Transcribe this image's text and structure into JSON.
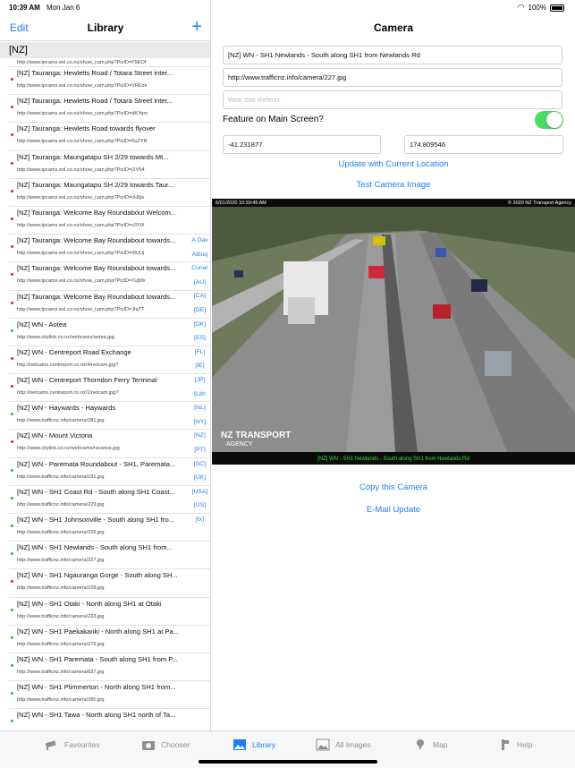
{
  "status": {
    "time": "10:39 AM",
    "date": "Mon Jan 6",
    "battery": "100%"
  },
  "left": {
    "edit_label": "Edit",
    "title": "Library",
    "add_label": "+",
    "section": "[NZ]",
    "items": [
      {
        "title": "",
        "url": "http://www.tpcams.eol.co.nz/show_cam.php?PicID=F5EOf",
        "dot": ""
      },
      {
        "title": "[NZ] Tauranga: Hewletts Road / Totara Street inter...",
        "url": "http://www.tpcams.eol.co.nz/show_cam.php?PicID=VREzk",
        "dot": "#e02020"
      },
      {
        "title": "[NZ] Tauranga: Hewletts Road / Totara Street inter...",
        "url": "http://www.tpcams.eol.co.nz/show_cam.php?PicID=dKYqm",
        "dot": "#e02020"
      },
      {
        "title": "[NZ] Tauranga: Hewletts Road towards flyover",
        "url": "http://www.tpcams.eol.co.nz/show_cam.php?PicID=0uZYR",
        "dot": "#e02020"
      },
      {
        "title": "[NZ] Tauranga: Maungatapu SH 2/29 towards Mt...",
        "url": "http://www.tpcams.eol.co.nz/show_cam.php?PicID=j1V54",
        "dot": "#e02020"
      },
      {
        "title": "[NZ] Tauranga: Maungatapu SH 2/29 towards Taur...",
        "url": "http://www.tpcams.eol.co.nz/show_cam.php?PicID=cH5jv",
        "dot": "#e02020"
      },
      {
        "title": "[NZ] Tauranga: Welcome Bay Roundabout Welcom...",
        "url": "http://www.tpcams.eol.co.nz/show_cam.php?PicID=v3YiX",
        "dot": "#e02020"
      },
      {
        "title": "[NZ] Tauranga: Welcome Bay Roundabout towards...",
        "url": "http://www.tpcams.eol.co.nz/show_cam.php?PicID=0IUUj",
        "dot": "#e02020"
      },
      {
        "title": "[NZ] Tauranga: Welcome Bay Roundabout towards...",
        "url": "http://www.tpcams.eol.co.nz/show_cam.php?PicID=Tu[Mx",
        "dot": "#e02020"
      },
      {
        "title": "[NZ] Tauranga: Welcome Bay Roundabout towards...",
        "url": "http://www.tpcams.eol.co.nz/show_cam.php?PicID=JIqTT",
        "dot": "#e02020"
      },
      {
        "title": "[NZ] WN - Aotea",
        "url": "http://www.citylink.co.nz/webcams/aotea.jpg",
        "dot": "#33b533"
      },
      {
        "title": "[NZ] WN - Centreport Road Exchange",
        "url": "http://netcams.centreport.co.nz/4/netcam.jpg?",
        "dot": "#e02020"
      },
      {
        "title": "[NZ] WN - Centreport Thorndon Ferry Terminal",
        "url": "http://netcams.centreport.co.nz/1/netcam.jpg?",
        "dot": "#e02020"
      },
      {
        "title": "[NZ] WN - Haywards - Haywards",
        "url": "http://www.trafficnz.info/camera/281.jpg",
        "dot": "#33b533"
      },
      {
        "title": "[NZ] WN - Mount Victoria",
        "url": "http://www.citylink.co.nz/webcams/ravance.jpg",
        "dot": "#e02020"
      },
      {
        "title": "[NZ] WN - Paremata Roundabout - SH1, Paremata...",
        "url": "http://www.trafficnz.info/camera/231.jpg",
        "dot": "#33b533"
      },
      {
        "title": "[NZ] WN - SH1 Coast Rd - South along SH1 Coast...",
        "url": "http://www.trafficnz.info/camera/229.jpg",
        "dot": "#33b533"
      },
      {
        "title": "[NZ] WN - SH1 Johnsonville - South along SH1 fro...",
        "url": "http://www.trafficnz.info/camera/226.jpg",
        "dot": "#33b533"
      },
      {
        "title": "[NZ] WN - SH1 Newlands - South along SH1 from...",
        "url": "http://www.trafficnz.info/camera/227.jpg",
        "dot": "#33b533"
      },
      {
        "title": "[NZ] WN - SH1 Ngauranga Gorge - South along SH...",
        "url": "http://www.trafficnz.info/camera/228.jpg",
        "dot": "#e02020"
      },
      {
        "title": "[NZ] WN - SH1 Otaki - North along SH1 at Otaki",
        "url": "http://www.trafficnz.info/camera/233.jpg",
        "dot": "#33b533"
      },
      {
        "title": "[NZ] WN - SH1 Paekakariki - North along SH1 at Pa...",
        "url": "http://www.trafficnz.info/camera/279.jpg",
        "dot": "#33b533"
      },
      {
        "title": "[NZ] WN - SH1 Paremata - South along SH1 from P...",
        "url": "http://www.trafficnz.info/camera/637.jpg",
        "dot": "#33b533"
      },
      {
        "title": "[NZ] WN - SH1 Plimmerton - North along SH1 from...",
        "url": "http://www.trafficnz.info/camera/280.jpg",
        "dot": "#33b533"
      },
      {
        "title": "[NZ] WN - SH1 Tawa - North along SH1 north of Ta...",
        "url": "",
        "dot": "#33b533"
      }
    ],
    "index": [
      "A Dav",
      "Albuq",
      "Cunar",
      "[AU]",
      "[CA]",
      "[DE]",
      "[DK]",
      "[ES]",
      "[FL]",
      "[IE]",
      "[JP]",
      "[Lith",
      "[NL]",
      "[NY]",
      "[NZ]",
      "[PT]",
      "[SC]",
      "[UK]",
      "[USA]",
      "[US]",
      "[tx]"
    ]
  },
  "right": {
    "title": "Camera",
    "name_value": "[NZ] WN - SH1 Newlands - South along SH1 from Newlands Rd",
    "url_value": "http://www.trafficnz.info/camera/227.jpg",
    "referer_placeholder": "Web Site Referer",
    "feature_label": "Feature on Main Screen?",
    "feature_on": true,
    "latitude": "-41.231877",
    "longitude": "174.809546",
    "update_location": "Update with Current Location",
    "test_image": "Test Camera Image",
    "image": {
      "timestamp": "6/01/2020 10:39:45 AM",
      "copyright": "© 2020 NZ Transport Agency",
      "caption": "[NZ] WN - SH1 Newlands - South along SH1 from Newlands Rd",
      "logo_main": "NZ TRANSPORT",
      "logo_sub": "AGENCY"
    },
    "copy_camera": "Copy this Camera",
    "email_update": "E-Mail Update"
  },
  "tabs": [
    {
      "label": "Favourites",
      "icon": "camera-cctv-icon",
      "active": false
    },
    {
      "label": "Chooser",
      "icon": "camera-icon",
      "active": false
    },
    {
      "label": "Library",
      "icon": "library-image-icon",
      "active": true
    },
    {
      "label": "All Images",
      "icon": "images-icon",
      "active": false
    },
    {
      "label": "Map",
      "icon": "map-pin-icon",
      "active": false
    },
    {
      "label": "Help",
      "icon": "help-icon",
      "active": false
    }
  ],
  "colors": {
    "accent": "#1d7ff4",
    "toggle": "#4cd964",
    "caption": "#2fe02f"
  }
}
